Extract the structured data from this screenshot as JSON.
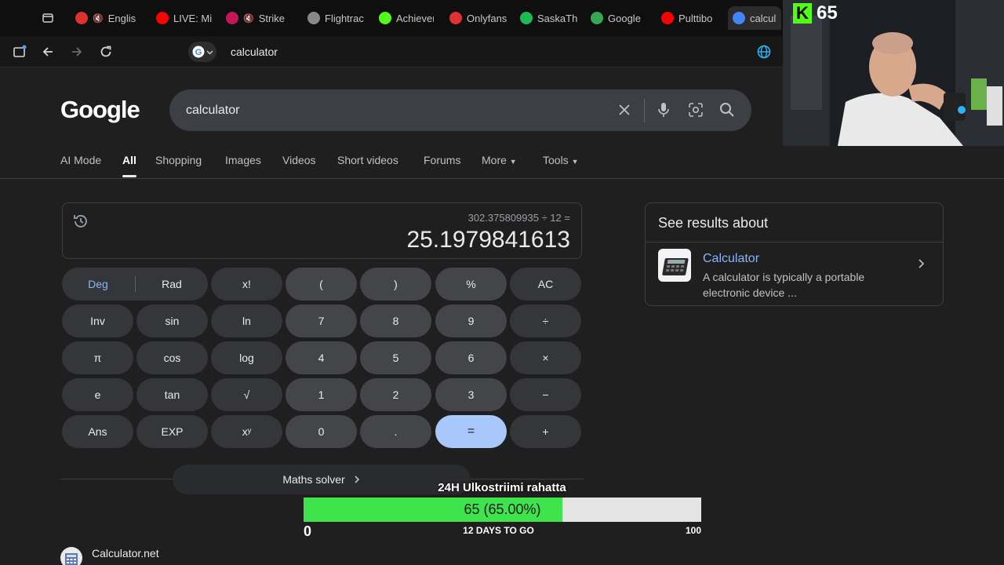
{
  "browser": {
    "tabs": [
      {
        "label": "Englis",
        "icon": "red-circle-icon",
        "color": "#e03131",
        "muted": true
      },
      {
        "label": "LIVE: Mi",
        "icon": "youtube-icon",
        "color": "#ff0000",
        "muted": false
      },
      {
        "label": "Strike",
        "icon": "strike-icon",
        "color": "#c2185b",
        "muted": true
      },
      {
        "label": "Flightrac",
        "icon": "flightradar-icon",
        "color": "#888888",
        "muted": false
      },
      {
        "label": "Achiever",
        "icon": "kick-icon",
        "color": "#53fc18",
        "muted": false
      },
      {
        "label": "Onlyfans",
        "icon": "onlyfans-icon",
        "color": "#e03131",
        "muted": false
      },
      {
        "label": "SaskaTh",
        "icon": "spotify-icon",
        "color": "#1db954",
        "muted": false
      },
      {
        "label": "Google",
        "icon": "maps-icon",
        "color": "#34a853",
        "muted": false
      },
      {
        "label": "Pulttibo",
        "icon": "youtube-icon",
        "color": "#ff0000",
        "muted": false
      },
      {
        "label": "calcul",
        "icon": "google-icon",
        "color": "#4285f4",
        "active": true
      }
    ],
    "address": "calculator"
  },
  "google": {
    "logo": "Google",
    "query": "calculator",
    "nav": [
      "AI Mode",
      "All",
      "Shopping",
      "Images",
      "Videos",
      "Short videos",
      "Forums",
      "More",
      "Tools"
    ],
    "nav_active": "All"
  },
  "calculator": {
    "expression": "302.375809935 ÷ 12 =",
    "result": "25.1979841613",
    "deg_label": "Deg",
    "rad_label": "Rad",
    "angle_mode": "Deg",
    "keys": [
      [
        "x!",
        "(",
        ")",
        "%",
        "AC"
      ],
      [
        "Inv",
        "sin",
        "ln",
        "7",
        "8",
        "9",
        "÷"
      ],
      [
        "π",
        "cos",
        "log",
        "4",
        "5",
        "6",
        "×"
      ],
      [
        "e",
        "tan",
        "√",
        "1",
        "2",
        "3",
        "−"
      ],
      [
        "Ans",
        "EXP",
        "xʸ",
        "0",
        ".",
        "=",
        "+"
      ]
    ],
    "solver_label": "Maths solver"
  },
  "result_site": {
    "name": "Calculator.net"
  },
  "knowledge_panel": {
    "title": "See results about",
    "name": "Calculator",
    "description": "A calculator is typically a portable electronic device ..."
  },
  "stream": {
    "viewer_count": "65",
    "goal_title": "24H Ulkostriimi rahatta",
    "goal_text": "65 (65.00%)",
    "goal_progress": 0.65,
    "goal_min": "0",
    "goal_remaining": "12 DAYS TO GO",
    "goal_max": "100"
  },
  "colors": {
    "accent_blue": "#8ab4f8",
    "equals_key": "#a8c7fa",
    "goal_green": "#3fe34b",
    "kick_green": "#53fc18"
  }
}
